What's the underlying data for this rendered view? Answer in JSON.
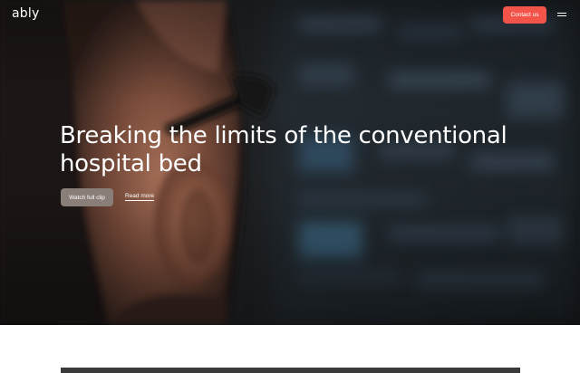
{
  "brand": {
    "logo_text": "ably",
    "accent_color": "#f2544a"
  },
  "header": {
    "contact_label": "Contact us",
    "menu_icon": "hamburger-menu-icon"
  },
  "hero": {
    "headline": "Breaking the limits of the conventional hospital bed",
    "watch_label": "Watch full clip",
    "read_more_label": "Read more"
  }
}
